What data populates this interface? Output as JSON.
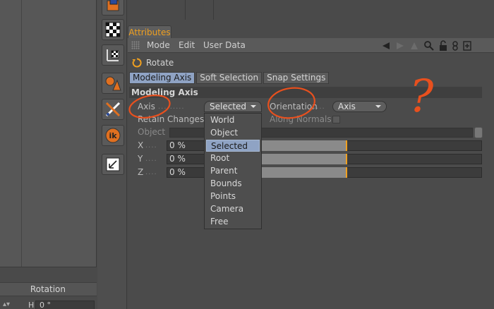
{
  "left": {
    "rotation_header": "Rotation",
    "h_label": "H",
    "h_value": "0 °"
  },
  "attributes": {
    "tab_label": "Attributes",
    "menu": [
      "Mode",
      "Edit",
      "User Data"
    ],
    "object_name": "Rotate",
    "sub_tabs": [
      "Modeling Axis",
      "Soft Selection",
      "Snap Settings"
    ],
    "active_sub_tab": "Modeling Axis",
    "section_title": "Modeling Axis",
    "axis_label": "Axis",
    "axis_value": "Selected",
    "orientation_label": "Orientation",
    "orientation_value": "Axis",
    "retain_label": "Retain Changes",
    "along_normals_label": "Along Normals",
    "object_label": "Object",
    "x_label": "X",
    "y_label": "Y",
    "z_label": "Z",
    "x_value": "0 %",
    "y_value": "0 %",
    "z_value": "0 %",
    "axis_options": [
      "World",
      "Object",
      "Selected",
      "Root",
      "Parent",
      "Bounds",
      "Points",
      "Camera",
      "Free"
    ],
    "selected_option": "Selected"
  },
  "annotation": {
    "question_mark": "?"
  },
  "colors": {
    "accent": "#f0a020",
    "selection": "#8fa3c4",
    "annotation": "#e8501e"
  }
}
